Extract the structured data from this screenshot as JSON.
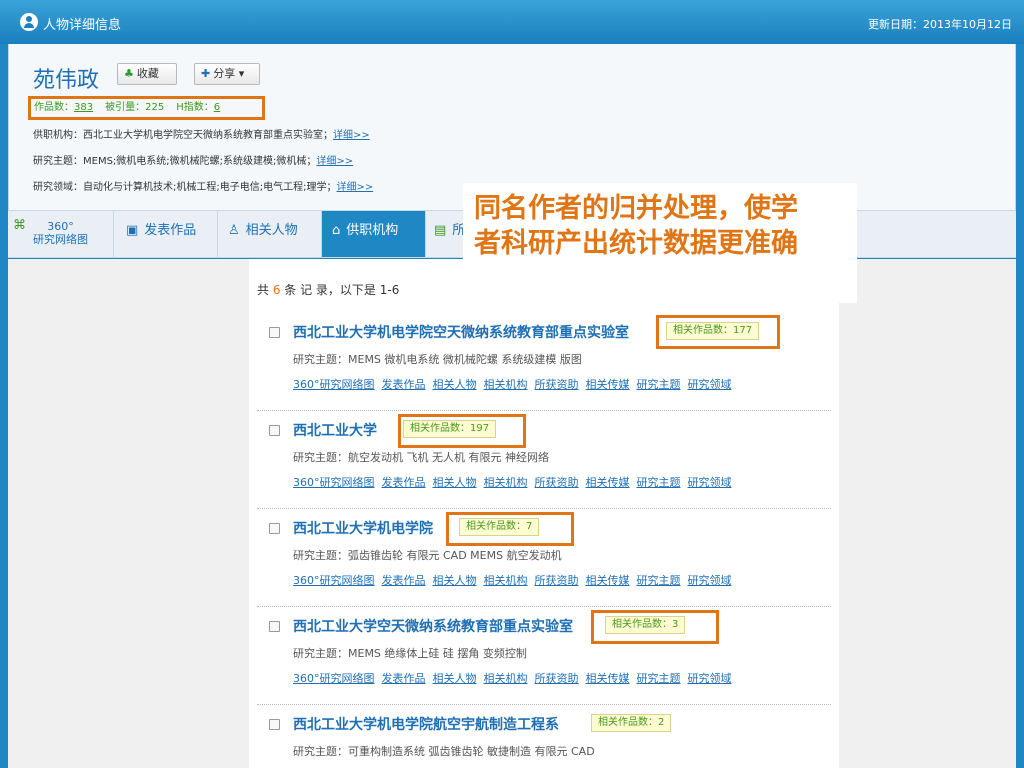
{
  "titlebar": {
    "title": "人物详细信息",
    "date": "更新日期：2013年10月12日"
  },
  "author": {
    "name": "苑伟政",
    "fav_label": "收藏",
    "share_label": "分享",
    "stats": {
      "works_label": "作品数：",
      "works": "383",
      "cited": "被引量：225",
      "h_label": "H指数：",
      "h": "6"
    },
    "institution_label": "供职机构：西北工业大学机电学院空天微纳系统教育部重点实验室；",
    "topics_label": "研究主题：MEMS;微机电系统;微机械陀螺;系统级建模;微机械；",
    "fields_label": "研究领域：自动化与计算机技术;机械工程;电子电信;电气工程;理学；",
    "detail_link": "详细>>"
  },
  "tabs": {
    "t360_a": "360°",
    "t360_b": "研究网络图",
    "works": "发表作品",
    "people": "相关人物",
    "inst": "供职机构",
    "fund": "所"
  },
  "overlay": {
    "line1": "同名作者的归并处理，使学",
    "line2": "者科研产出统计数据更准确"
  },
  "records": {
    "prefix": "共 ",
    "num": "6",
    "suffix": " 条 记 录，以下是 1-6"
  },
  "link_labels": [
    "360°研究网络图",
    "发表作品",
    "相关人物",
    "相关机构",
    "所获资助",
    "相关传媒",
    "研究主题",
    "研究领域"
  ],
  "items": [
    {
      "title": "西北工业大学机电学院空天微纳系统教育部重点实验室",
      "badge": "相关作品数：177",
      "topics": "研究主题：MEMS 微机电系统 微机械陀螺 系统级建模 版图"
    },
    {
      "title": "西北工业大学",
      "badge": "相关作品数：197",
      "topics": "研究主题：航空发动机 飞机 无人机 有限元 神经网络"
    },
    {
      "title": "西北工业大学机电学院",
      "badge": "相关作品数：7",
      "topics": "研究主题：弧齿锥齿轮 有限元 CAD MEMS 航空发动机"
    },
    {
      "title": "西北工业大学空天微纳系统教育部重点实验室",
      "badge": "相关作品数：3",
      "topics": "研究主题：MEMS 绝缘体上硅 硅 摆角 变频控制"
    },
    {
      "title": "西北工业大学机电学院航空宇航制造工程系",
      "badge": "相关作品数：2",
      "topics": "研究主题：可重构制造系统 弧齿锥齿轮 敏捷制造 有限元 CAD"
    }
  ]
}
